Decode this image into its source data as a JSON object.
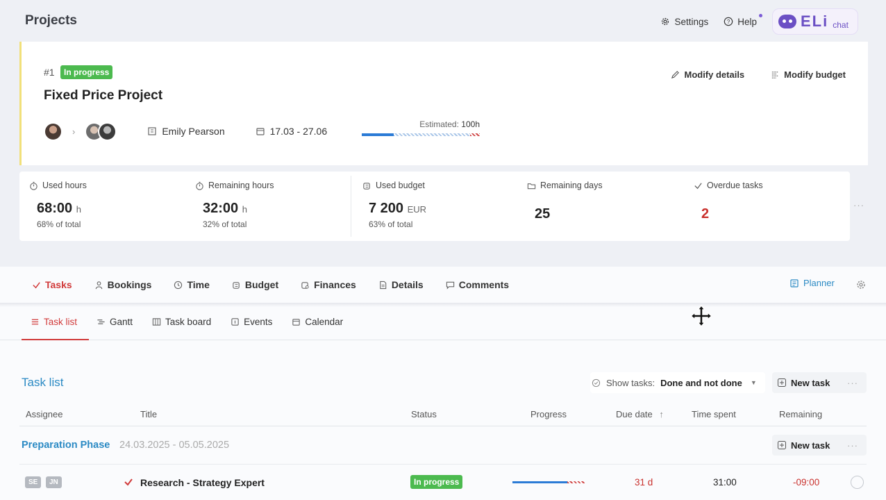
{
  "header": {
    "title": "Projects",
    "settings_label": "Settings",
    "help_label": "Help",
    "chat_logo_text": "ELi",
    "chat_logo_sub": "chat"
  },
  "project": {
    "number": "#1",
    "status": "In progress",
    "title": "Fixed Price Project",
    "modify_details": "Modify details",
    "modify_budget": "Modify budget",
    "manager": "Emily Pearson",
    "dates": "17.03 - 27.06",
    "estimated_label": "Estimated:",
    "estimated_value": "100h",
    "estimate_progress": 0.27
  },
  "stats": {
    "used_hours": {
      "label": "Used hours",
      "value": "68:00",
      "unit": "h",
      "sub": "68% of total"
    },
    "remaining_hours": {
      "label": "Remaining hours",
      "value": "32:00",
      "unit": "h",
      "sub": "32% of total"
    },
    "used_budget": {
      "label": "Used budget",
      "value": "7 200",
      "unit": "EUR",
      "sub": "63% of total"
    },
    "remaining_days": {
      "label": "Remaining days",
      "value": "25"
    },
    "overdue_tasks": {
      "label": "Overdue tasks",
      "value": "2"
    },
    "more": "···"
  },
  "tabs": [
    "Tasks",
    "Bookings",
    "Time",
    "Budget",
    "Finances",
    "Details",
    "Comments"
  ],
  "planner_label": "Planner",
  "subtabs": [
    "Task list",
    "Gantt",
    "Task board",
    "Events",
    "Calendar"
  ],
  "task_list": {
    "title": "Task list",
    "show_tasks_label": "Show tasks:",
    "show_tasks_value": "Done and not done",
    "new_task": "New task",
    "more": "···",
    "columns": {
      "assignee": "Assignee",
      "title": "Title",
      "status": "Status",
      "progress": "Progress",
      "due_date": "Due date",
      "time_spent": "Time spent",
      "remaining": "Remaining"
    },
    "phase": {
      "title": "Preparation Phase",
      "dates": "24.03.2025 - 05.05.2025"
    },
    "rows": [
      {
        "assignees": [
          "SE",
          "JN"
        ],
        "title": "Research - Strategy Expert",
        "status": "In progress",
        "progress": 0.76,
        "due": "31 d",
        "spent": "31:00",
        "remaining": "-09:00"
      }
    ]
  },
  "colors": {
    "accent_red": "#d13a3a",
    "accent_blue": "#2b8ac4",
    "status_green": "#4cba4f",
    "progress_blue": "#2b7bd6",
    "overdue_red": "#c9302c"
  }
}
